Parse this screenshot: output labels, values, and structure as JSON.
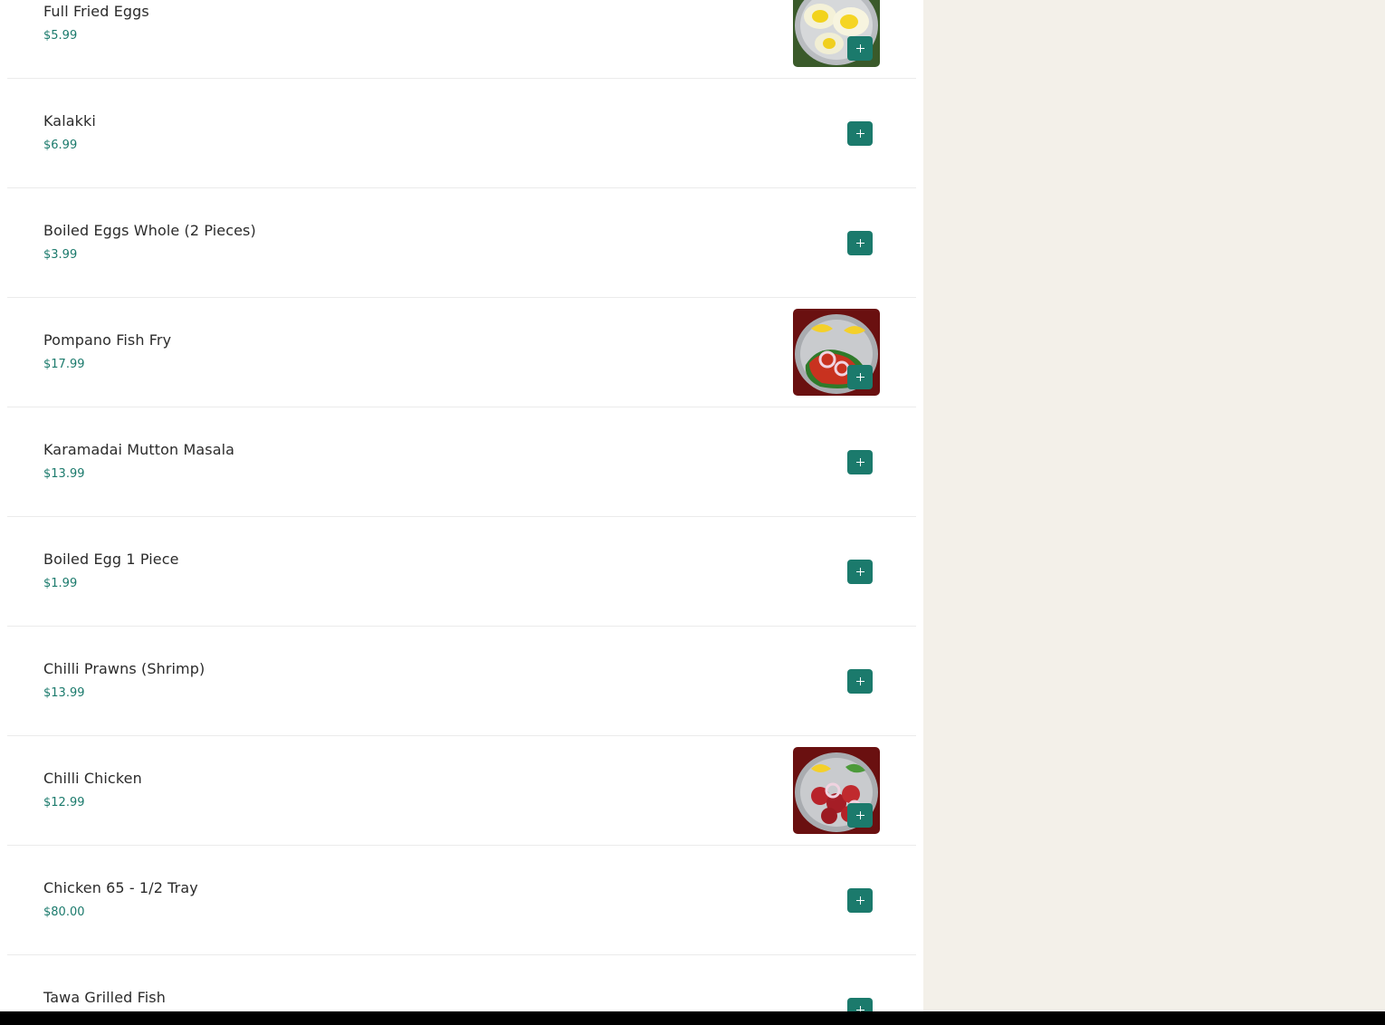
{
  "colors": {
    "accent": "#1b7a6c",
    "side_panel": "#f3f0e9",
    "item_name": "#2b2b2b"
  },
  "menu": {
    "items": [
      {
        "name": "Full Fried Eggs",
        "price": "$5.99",
        "has_image": true,
        "image_icon": "fried-eggs-dish-image"
      },
      {
        "name": "Kalakki",
        "price": "$6.99",
        "has_image": false
      },
      {
        "name": "Boiled Eggs Whole (2 Pieces)",
        "price": "$3.99",
        "has_image": false
      },
      {
        "name": "Pompano Fish Fry",
        "price": "$17.99",
        "has_image": true,
        "image_icon": "fish-fry-dish-image"
      },
      {
        "name": "Karamadai Mutton Masala",
        "price": "$13.99",
        "has_image": false
      },
      {
        "name": "Boiled Egg 1 Piece",
        "price": "$1.99",
        "has_image": false
      },
      {
        "name": "Chilli Prawns (Shrimp)",
        "price": "$13.99",
        "has_image": false
      },
      {
        "name": "Chilli Chicken",
        "price": "$12.99",
        "has_image": true,
        "image_icon": "chilli-chicken-dish-image"
      },
      {
        "name": "Chicken 65 - 1/2 Tray",
        "price": "$80.00",
        "has_image": false
      },
      {
        "name": "Tawa Grilled Fish",
        "price": "",
        "has_image": false
      }
    ],
    "add_icon": "plus-icon"
  }
}
